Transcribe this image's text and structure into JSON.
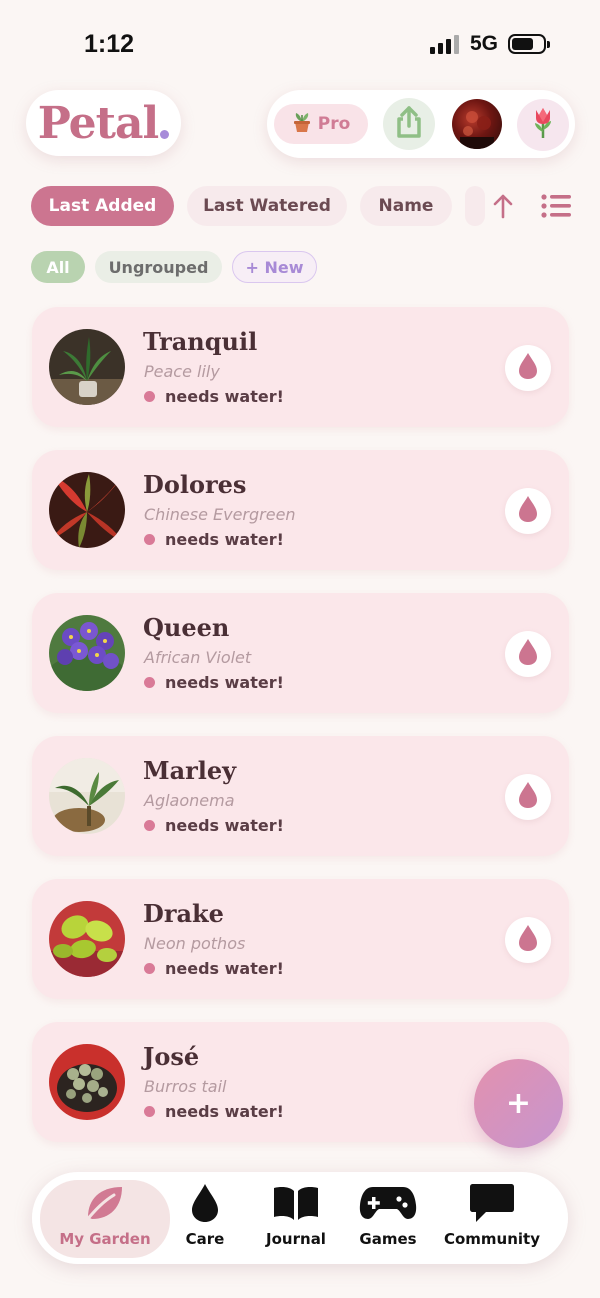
{
  "status_bar": {
    "time": "1:12",
    "network": "5G"
  },
  "header": {
    "logo": "Petal",
    "pro_label": "Pro",
    "pro_icon": "potted-plant-icon",
    "share_icon": "share-icon",
    "tulip_icon": "tulip-icon"
  },
  "sort": {
    "options": [
      "Last Added",
      "Last Watered",
      "Name"
    ],
    "active": "Last Added",
    "direction_icon": "arrow-up-icon",
    "view_icon": "list-view-icon"
  },
  "groups": {
    "options": [
      "All",
      "Ungrouped"
    ],
    "new_label": "+ New"
  },
  "plants": [
    {
      "name": "Tranquil",
      "species": "Peace lily",
      "status": "needs water!"
    },
    {
      "name": "Dolores",
      "species": "Chinese Evergreen",
      "status": "needs water!"
    },
    {
      "name": "Queen",
      "species": "African Violet",
      "status": "needs water!"
    },
    {
      "name": "Marley",
      "species": "Aglaonema",
      "status": "needs water!"
    },
    {
      "name": "Drake",
      "species": "Neon pothos",
      "status": "needs water!"
    },
    {
      "name": "José",
      "species": "Burros tail",
      "status": "needs water!"
    }
  ],
  "fab": {
    "label": "+"
  },
  "tabs": [
    {
      "label": "My Garden",
      "icon": "leaf-icon"
    },
    {
      "label": "Care",
      "icon": "water-drop-icon"
    },
    {
      "label": "Journal",
      "icon": "book-icon"
    },
    {
      "label": "Games",
      "icon": "gamepad-icon"
    },
    {
      "label": "Community",
      "icon": "chat-bubble-icon"
    }
  ],
  "colors": {
    "brand": "#c56f88",
    "accent_purple": "#a78bd9",
    "card_bg": "#fbe7ea",
    "status_dot": "#d97a97",
    "background": "#fbf6f4"
  }
}
